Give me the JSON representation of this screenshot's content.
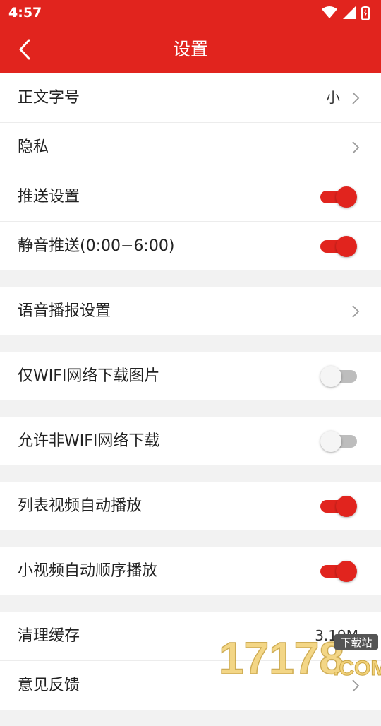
{
  "status": {
    "time": "4:57"
  },
  "header": {
    "title": "设置"
  },
  "groups": [
    {
      "rows": [
        {
          "label": "正文字号",
          "value": "小",
          "control": "chevron"
        },
        {
          "label": "隐私",
          "control": "chevron"
        },
        {
          "label": "推送设置",
          "control": "toggle",
          "on": true
        },
        {
          "label": "静音推送(0:00−6:00)",
          "control": "toggle",
          "on": true
        }
      ]
    },
    {
      "rows": [
        {
          "label": "语音播报设置",
          "control": "chevron"
        }
      ]
    },
    {
      "rows": [
        {
          "label": "仅WIFI网络下载图片",
          "control": "toggle",
          "on": false
        }
      ]
    },
    {
      "rows": [
        {
          "label": "允许非WIFI网络下载",
          "control": "toggle",
          "on": false
        }
      ]
    },
    {
      "rows": [
        {
          "label": "列表视频自动播放",
          "control": "toggle",
          "on": true
        }
      ]
    },
    {
      "rows": [
        {
          "label": "小视频自动顺序播放",
          "control": "toggle",
          "on": true
        }
      ]
    },
    {
      "rows": [
        {
          "label": "清理缓存",
          "value": "3.19M",
          "control": "value"
        },
        {
          "label": "意见反馈",
          "control": "chevron"
        }
      ]
    }
  ],
  "watermark": {
    "digits": "17178",
    "tag": "下载站",
    "domain": ".COM"
  },
  "colors": {
    "accent": "#e1241e",
    "background": "#f2f2f2"
  },
  "icons": {
    "back": "back-arrow-icon",
    "wifi": "wifi-icon",
    "signal": "signal-icon",
    "battery": "battery-charging-icon",
    "chevron": "chevron-right-icon"
  }
}
